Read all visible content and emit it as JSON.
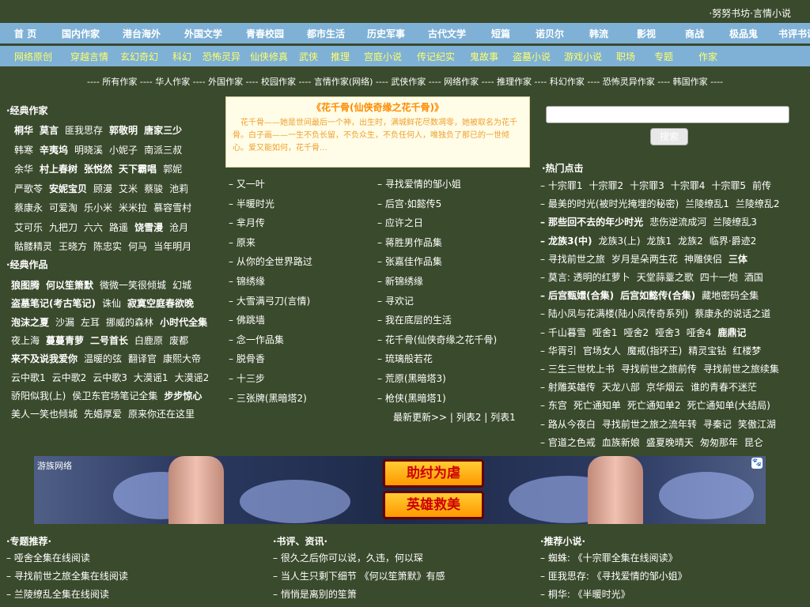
{
  "top_links": "·努努书坊·言情小说",
  "nav1": [
    "首 页",
    "国内作家",
    "港台海外",
    "外国文学",
    "青春校园",
    "都市生活",
    "历史军事",
    "古代文学",
    "短篇",
    "诺贝尔",
    "韩流",
    "影视",
    "商战",
    "极品鬼",
    "书评书讯"
  ],
  "nav2": [
    "网络原创",
    "穿越言情",
    "玄幻奇幻",
    "科幻",
    "恐怖灵异",
    "仙侠修真",
    "武侠",
    "推理",
    "宫庭小说",
    "传记纪实",
    "鬼故事",
    "盗墓小说",
    "游戏小说",
    "职场",
    "专题",
    "作家"
  ],
  "writer_categories": "---- 所有作家 ---- 华人作家 ---- 外国作家 ---- 校园作家 ---- 言情作家(网络) ---- 武侠作家 ---- 网络作家 ---- 推理作家 ---- 科幻作家 ---- 恐怖灵异作家 ---- 韩国作家 ----",
  "classic_authors_title": "·经典作家",
  "classic_authors": [
    [
      {
        "t": "桐华",
        "b": true
      },
      {
        "t": "莫言",
        "b": true
      },
      {
        "t": "匪我思存",
        "b": false
      },
      {
        "t": "郭敬明",
        "b": true
      },
      {
        "t": "唐家三少",
        "b": true
      }
    ],
    [
      {
        "t": "韩寒",
        "b": false
      },
      {
        "t": "辛夷坞",
        "b": true
      },
      {
        "t": "明晓溪",
        "b": false
      },
      {
        "t": "小妮子",
        "b": false
      },
      {
        "t": "南派三叔",
        "b": false
      }
    ],
    [
      {
        "t": "余华",
        "b": false
      },
      {
        "t": "村上春树",
        "b": true
      },
      {
        "t": "张悦然",
        "b": true
      },
      {
        "t": "天下霸唱",
        "b": true
      },
      {
        "t": "郭妮",
        "b": false
      }
    ],
    [
      {
        "t": "严歌苓",
        "b": false
      },
      {
        "t": "安妮宝贝",
        "b": true
      },
      {
        "t": "顾漫",
        "b": false
      },
      {
        "t": "艾米",
        "b": false
      },
      {
        "t": "蔡骏",
        "b": false
      },
      {
        "t": "池莉",
        "b": false
      }
    ],
    [
      {
        "t": "蔡康永",
        "b": false
      },
      {
        "t": "可爱淘",
        "b": false
      },
      {
        "t": "乐小米",
        "b": false
      },
      {
        "t": "米米拉",
        "b": false
      },
      {
        "t": "慕容雪村",
        "b": false
      }
    ],
    [
      {
        "t": "艾可乐",
        "b": false
      },
      {
        "t": "九把刀",
        "b": false
      },
      {
        "t": "六六",
        "b": false
      },
      {
        "t": "路遥",
        "b": false
      },
      {
        "t": "饶雪漫",
        "b": true
      },
      {
        "t": "沧月",
        "b": false
      }
    ],
    [
      {
        "t": "骷髅精灵",
        "b": false
      },
      {
        "t": "王晓方",
        "b": false
      },
      {
        "t": "陈忠实",
        "b": false
      },
      {
        "t": "何马",
        "b": false
      },
      {
        "t": "当年明月",
        "b": false
      }
    ]
  ],
  "classic_works_title": "·经典作品",
  "classic_works": [
    [
      {
        "t": "狼图腾",
        "b": true
      },
      {
        "t": "何以笙箫默",
        "b": true
      },
      {
        "t": "微微一笑很倾城",
        "b": false
      },
      {
        "t": "幻城",
        "b": false
      }
    ],
    [
      {
        "t": "盗墓笔记(考古笔记)",
        "b": true
      },
      {
        "t": "诛仙",
        "b": false
      },
      {
        "t": "寂寞空庭春欲晚",
        "b": true
      }
    ],
    [
      {
        "t": "泡沫之夏",
        "b": true
      },
      {
        "t": "沙漏",
        "b": false
      },
      {
        "t": "左耳",
        "b": false
      },
      {
        "t": "挪威的森林",
        "b": false
      },
      {
        "t": "小时代全集",
        "b": true
      }
    ],
    [
      {
        "t": "夜上海",
        "b": false
      },
      {
        "t": "蔓蔓青萝",
        "b": true
      },
      {
        "t": "二号首长",
        "b": true
      },
      {
        "t": "白鹿原",
        "b": false
      },
      {
        "t": "废都",
        "b": false
      }
    ],
    [
      {
        "t": "来不及说我爱你",
        "b": true
      },
      {
        "t": "温暖的弦",
        "b": false
      },
      {
        "t": "翻译官",
        "b": false
      },
      {
        "t": "康熙大帝",
        "b": false
      }
    ],
    [
      {
        "t": "云中歌1",
        "b": false
      },
      {
        "t": "云中歌2",
        "b": false
      },
      {
        "t": "云中歌3",
        "b": false
      },
      {
        "t": "大漠谣1",
        "b": false
      },
      {
        "t": "大漠谣2",
        "b": false
      }
    ],
    [
      {
        "t": "骄阳似我(上)",
        "b": false
      },
      {
        "t": "侯卫东官场笔记全集",
        "b": false
      },
      {
        "t": "步步惊心",
        "b": true
      }
    ],
    [
      {
        "t": "美人一笑也倾城",
        "b": false
      },
      {
        "t": "先婚厚爱",
        "b": false
      },
      {
        "t": "原来你还在这里",
        "b": false
      }
    ]
  ],
  "featured": {
    "title": "《花千骨(仙侠奇缘之花千骨)》",
    "text": "　花千骨——她是世间最后一个神，出生时，满城鲜花尽数凋零，她被取名为花千骨。白子画——一生不负长留，不负众生，不负任何人，唯独负了那已的一世倾心。爱又能如何，花千骨..."
  },
  "search": {
    "placeholder": "",
    "button": "搜索"
  },
  "list_mid": [
    "– 又一叶",
    "– 半暖时光",
    "– 芈月传",
    "– 原来",
    "– 从你的全世界路过",
    "– 锦绣缘",
    "– 大雪满弓刀(言情)",
    "– 佛跳墙",
    "– 念一作品集",
    "– 脱骨香",
    "– 十三步",
    "– 三张牌(黑暗塔2)"
  ],
  "list_right": [
    "– 寻找爱情的邹小姐",
    "– 后宫·如懿传5",
    "– 应许之日",
    "– 蒋胜男作品集",
    "– 张嘉佳作品集",
    "– 新锦绣缘",
    "– 寻欢记",
    "– 我在底层的生活",
    "– 花千骨(仙侠奇缘之花千骨)",
    "– 琉璃般若花",
    "– 荒原(黑暗塔3)",
    "– 枪侠(黑暗塔1)"
  ],
  "more_links": "最新更新>> | 列表2 | 列表1",
  "hot_title": "·热门点击",
  "hot": [
    [
      {
        "t": "– 十宗罪1",
        "b": false
      },
      {
        "t": "十宗罪2",
        "b": false
      },
      {
        "t": "十宗罪3",
        "b": false
      },
      {
        "t": "十宗罪4",
        "b": false
      },
      {
        "t": "十宗罪5",
        "b": false
      },
      {
        "t": "前传",
        "b": false
      }
    ],
    [
      {
        "t": "– 最美的时光(被时光掩埋的秘密)",
        "b": false
      },
      {
        "t": "兰陵缭乱1",
        "b": false
      },
      {
        "t": "兰陵缭乱2",
        "b": false
      }
    ],
    [
      {
        "t": "– 那些回不去的年少时光",
        "b": true
      },
      {
        "t": "悲伤逆流成河",
        "b": false
      },
      {
        "t": "兰陵缭乱3",
        "b": false
      }
    ],
    [
      {
        "t": "– 龙族3(中)",
        "b": true
      },
      {
        "t": "龙族3(上)",
        "b": false
      },
      {
        "t": "龙族1",
        "b": false
      },
      {
        "t": "龙族2",
        "b": false
      },
      {
        "t": "临界·爵迹2",
        "b": false
      }
    ],
    [
      {
        "t": "– 寻找前世之旅",
        "b": false
      },
      {
        "t": "岁月是朵两生花",
        "b": false
      },
      {
        "t": "神雕侠侣",
        "b": false
      },
      {
        "t": "三体",
        "b": true
      }
    ],
    [
      {
        "t": "– 莫言: 透明的红萝卜",
        "b": false
      },
      {
        "t": "天堂蒜薹之歌",
        "b": false
      },
      {
        "t": "四十一炮",
        "b": false
      },
      {
        "t": "酒国",
        "b": false
      }
    ],
    [
      {
        "t": "– 后宫甄嬛(合集)",
        "b": true
      },
      {
        "t": "后宫如懿传(合集)",
        "b": true
      },
      {
        "t": "藏地密码全集",
        "b": false
      }
    ],
    [
      {
        "t": "– 陆小凤与花满楼(陆小凤传奇系列)",
        "b": false
      },
      {
        "t": "蔡康永的说话之道",
        "b": false
      }
    ],
    [
      {
        "t": "– 千山暮雪",
        "b": false
      },
      {
        "t": "哑舍1",
        "b": false
      },
      {
        "t": "哑舍2",
        "b": false
      },
      {
        "t": "哑舍3",
        "b": false
      },
      {
        "t": "哑舍4",
        "b": false
      },
      {
        "t": "鹿鼎记",
        "b": true
      }
    ],
    [
      {
        "t": "– 华胥引",
        "b": false
      },
      {
        "t": "官场女人",
        "b": false
      },
      {
        "t": "魔戒(指环王)",
        "b": false
      },
      {
        "t": "精灵宝钻",
        "b": false
      },
      {
        "t": "红楼梦",
        "b": false
      }
    ],
    [
      {
        "t": "– 三生三世枕上书",
        "b": false
      },
      {
        "t": "寻找前世之旅前传",
        "b": false
      },
      {
        "t": "寻找前世之旅续集",
        "b": false
      }
    ],
    [
      {
        "t": "– 射雕英雄传",
        "b": false
      },
      {
        "t": "天龙八部",
        "b": false
      },
      {
        "t": "京华烟云",
        "b": false
      },
      {
        "t": "谁的青春不迷茫",
        "b": false
      }
    ],
    [
      {
        "t": "– 东宫",
        "b": false
      },
      {
        "t": "死亡通知单",
        "b": false
      },
      {
        "t": "死亡通知单2",
        "b": false
      },
      {
        "t": "死亡通知单(大结局)",
        "b": false
      }
    ],
    [
      {
        "t": "– 路从今夜白",
        "b": false
      },
      {
        "t": "寻找前世之旅之流年转",
        "b": false
      },
      {
        "t": "寻秦记",
        "b": false
      },
      {
        "t": "笑傲江湖",
        "b": false
      }
    ],
    [
      {
        "t": "– 官道之色戒",
        "b": false
      },
      {
        "t": "血族新娘",
        "b": false
      },
      {
        "t": "盛夏晚晴天",
        "b": false
      },
      {
        "t": "匆匆那年",
        "b": false
      },
      {
        "t": "昆仑",
        "b": false
      }
    ]
  ],
  "ad": {
    "logo": "游族网络",
    "btn1": "助纣为虐",
    "btn2": "英雄救美",
    "paw": "🐾"
  },
  "footer": {
    "col1_title": "·专题推荐·",
    "col1": [
      "– 哑舍全集在线阅读",
      "– 寻找前世之旅全集在线阅读",
      "– 兰陵缭乱全集在线阅读"
    ],
    "col2_title": "·书评、资讯·",
    "col2": [
      "– 很久之后你可以说，久违，何以琛",
      "– 当人生只剩下细节 《何以笙箫默》有感",
      "– 悄悄是离别的笙箫"
    ],
    "col3_title": "·推荐小说·",
    "col3": [
      "– 蜘蛛: 《十宗罪全集在线阅读》",
      "– 匪我思存: 《寻找爱情的邹小姐》",
      "– 桐华: 《半暖时光》"
    ]
  }
}
